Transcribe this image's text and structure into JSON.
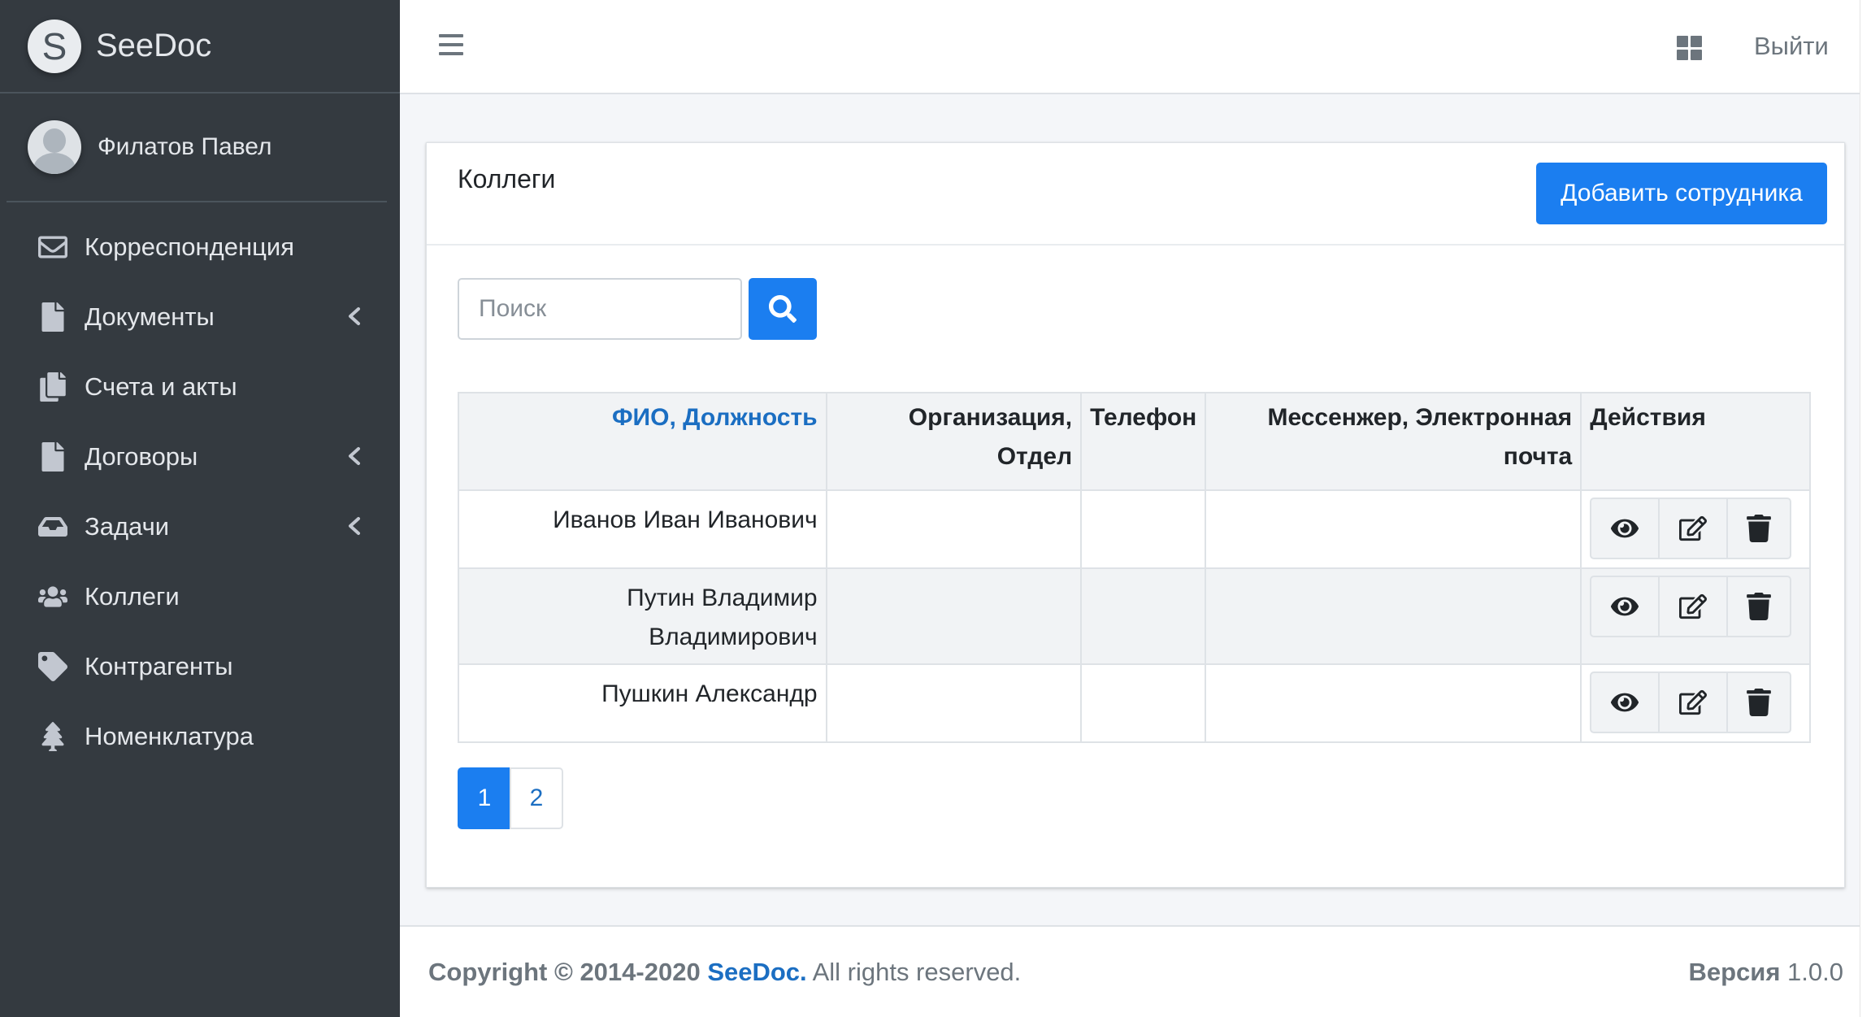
{
  "brand": {
    "logo_letter": "S",
    "name": "SeeDoc"
  },
  "user": {
    "name": "Филатов Павел"
  },
  "sidebar": {
    "items": [
      {
        "label": "Корреспонденция",
        "icon": "envelope-icon",
        "has_submenu": false
      },
      {
        "label": "Документы",
        "icon": "file-icon",
        "has_submenu": true
      },
      {
        "label": "Счета и акты",
        "icon": "copy-icon",
        "has_submenu": false
      },
      {
        "label": "Договоры",
        "icon": "file-icon",
        "has_submenu": true
      },
      {
        "label": "Задачи",
        "icon": "inbox-icon",
        "has_submenu": true
      },
      {
        "label": "Коллеги",
        "icon": "users-icon",
        "has_submenu": false
      },
      {
        "label": "Контрагенты",
        "icon": "tag-icon",
        "has_submenu": false
      },
      {
        "label": "Номенклатура",
        "icon": "tree-icon",
        "has_submenu": false
      }
    ]
  },
  "topbar": {
    "logout_label": "Выйти"
  },
  "card": {
    "title": "Коллеги",
    "add_button_label": "Добавить сотрудника",
    "search": {
      "placeholder": "Поиск",
      "value": ""
    }
  },
  "table": {
    "headers": {
      "name": "ФИО, Должность",
      "org": "Организация, Отдел",
      "phone": "Телефон",
      "contact": "Мессенжер, Электронная почта",
      "actions": "Действия"
    },
    "rows": [
      {
        "name": "Иванов Иван Иванович",
        "org": "",
        "phone": "",
        "contact": ""
      },
      {
        "name": "Путин Владимир Владимирович",
        "org": "",
        "phone": "",
        "contact": ""
      },
      {
        "name": "Пушкин Александр",
        "org": "",
        "phone": "",
        "contact": ""
      }
    ]
  },
  "pagination": {
    "pages": [
      "1",
      "2"
    ],
    "current": "1"
  },
  "footer": {
    "copyright_prefix": "Copyright © 2014-2020",
    "brand_link": "SeeDoc.",
    "rights": "All rights reserved.",
    "version_label": "Версия",
    "version_value": "1.0.0"
  },
  "colors": {
    "sidebar_bg": "#343a40",
    "primary": "#1b7ef0",
    "link": "#1b6ec2"
  }
}
